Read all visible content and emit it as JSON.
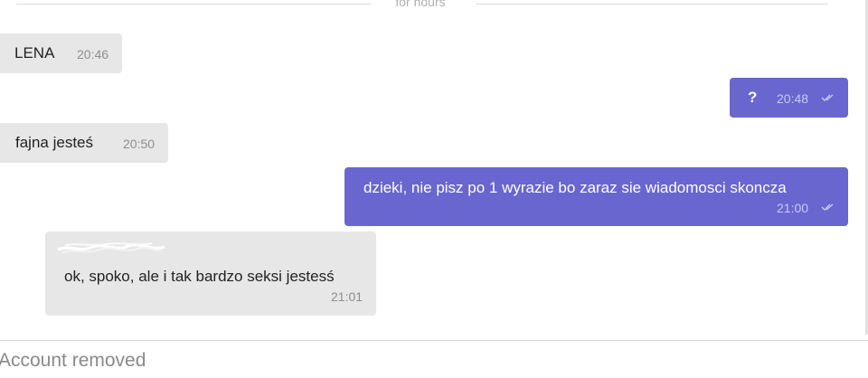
{
  "divider": {
    "label": "for hours"
  },
  "messages": [
    {
      "text": "LENA",
      "time": "20:46",
      "direction": "incoming"
    },
    {
      "text": "?",
      "time": "20:48",
      "direction": "outgoing",
      "status_icon": "double-check-icon"
    },
    {
      "text": "fajna jesteś",
      "time": "20:50",
      "direction": "incoming"
    },
    {
      "text": "dzieki, nie pisz po 1 wyrazie bo zaraz sie wiadomosci skoncza",
      "time": "21:00",
      "direction": "outgoing",
      "status_icon": "double-check-icon"
    },
    {
      "text": "ok, spoko, ale i tak bardzo seksi jestesś",
      "time": "21:01",
      "direction": "incoming",
      "quoted": "scribbled-out-sender-name"
    }
  ],
  "footer": {
    "status": "Account removed"
  },
  "colors": {
    "outgoing_bubble": "#6966d0",
    "incoming_bubble": "#e7e7e7",
    "background": "#ffffff"
  }
}
